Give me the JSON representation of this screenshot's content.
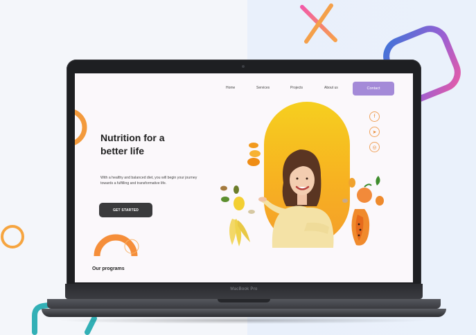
{
  "site": {
    "nav": {
      "links": [
        "Home",
        "Services",
        "Projects",
        "About us"
      ],
      "contact_label": "Contact"
    },
    "hero": {
      "title": "Nutrition for a better life",
      "description": "With a healthy and balanced diet, you will begin your journey towards a fulfilling and transformative life.",
      "cta_label": "GET STARTED"
    },
    "social_icons": [
      "facebook-icon",
      "telegram-icon",
      "instagram-icon"
    ],
    "section_heading": "Our programs"
  },
  "device": {
    "brand_label": "MacBook Pro"
  },
  "colors": {
    "accent_purple": "#a48ad8",
    "cta_dark": "#3a3a3c",
    "hero_yellow": "#f6cf1f",
    "hero_orange": "#f49e2a"
  }
}
